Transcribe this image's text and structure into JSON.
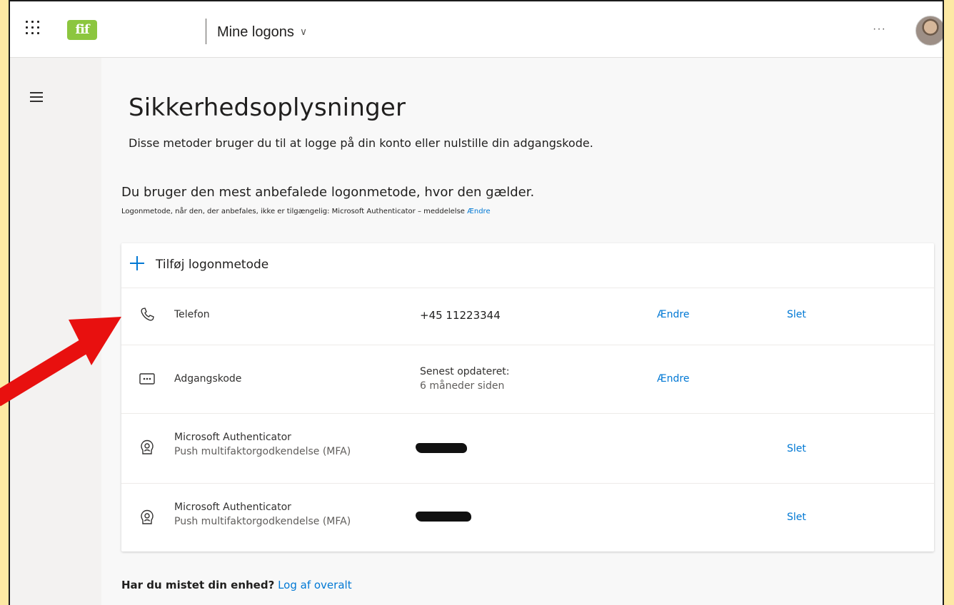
{
  "header": {
    "app_title": "Mine logons",
    "title_chevron": "∨",
    "more_label": "···",
    "logo_text": "fif",
    "logo_color": "#8cc63f"
  },
  "page": {
    "title": "Sikkerhedsoplysninger",
    "subtitle": "Disse metoder bruger du til at logge på din konto eller nulstille din adgangskode.",
    "recommended_text": "Du bruger den mest anbefalede logonmetode, hvor den gælder.",
    "fallback_text": "Logonmetode, når den, der anbefales, ikke er tilgængelig: Microsoft Authenticator – meddelelse",
    "fallback_change": "Ændre"
  },
  "methods": {
    "add_label": "Tilføj logonmetode",
    "items": [
      {
        "icon": "phone-icon",
        "name": "Telefon",
        "value": "+45 11223344",
        "change": "Ændre",
        "delete": "Slet"
      },
      {
        "icon": "password-icon",
        "name": "Adgangskode",
        "value_line1": "Senest opdateret:",
        "value_line2": "6 måneder siden",
        "change": "Ændre"
      },
      {
        "icon": "authenticator-icon",
        "name": "Microsoft Authenticator",
        "subtitle": "Push multifaktorgodkendelse (MFA)",
        "delete": "Slet"
      },
      {
        "icon": "authenticator-icon",
        "name": "Microsoft Authenticator",
        "subtitle": "Push multifaktorgodkendelse (MFA)",
        "delete": "Slet"
      }
    ]
  },
  "footer": {
    "lost_device_question": "Har du mistet din enhed?",
    "lost_device_link": "Log af overalt"
  },
  "colors": {
    "accent": "#0078d4",
    "annotation_arrow": "#e8100f",
    "outer_background": "#fde9a4"
  }
}
